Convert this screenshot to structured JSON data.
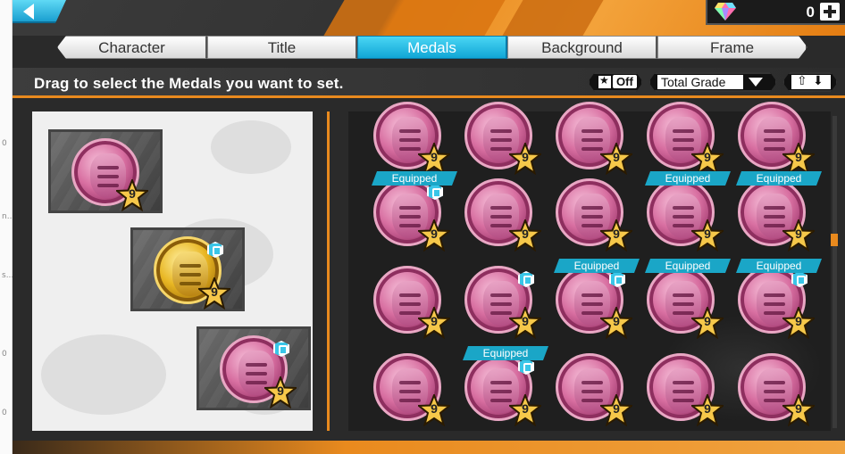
{
  "page_strip": {
    "marks": [
      "0",
      "n...",
      "s...",
      "0",
      "0"
    ]
  },
  "header": {
    "gems": {
      "count": "0"
    }
  },
  "tabs": [
    {
      "label": "Character",
      "active": false
    },
    {
      "label": "Title",
      "active": false
    },
    {
      "label": "Medals",
      "active": true
    },
    {
      "label": "Background",
      "active": false
    },
    {
      "label": "Frame",
      "active": false
    }
  ],
  "toolbar": {
    "instruction": "Drag to select the Medals you want to set.",
    "filter_off_label": "Off",
    "sort_label": "Total Grade"
  },
  "selected_medals": [
    {
      "level": "9",
      "color": "pink",
      "locked": false
    },
    {
      "level": "9",
      "color": "gold",
      "locked": true
    },
    {
      "level": "9",
      "color": "pink",
      "locked": true
    }
  ],
  "medal_grid": {
    "equipped_label": "Equipped",
    "rows": [
      [
        {
          "level": "9"
        },
        {
          "level": "9"
        },
        {
          "level": "9"
        },
        {
          "level": "9"
        },
        {
          "level": "9"
        }
      ],
      [
        {
          "level": "9",
          "equipped": true,
          "locked": true
        },
        {
          "level": "9"
        },
        {
          "level": "9"
        },
        {
          "level": "9",
          "equipped": true
        },
        {
          "level": "9",
          "equipped": true
        }
      ],
      [
        {
          "level": "9"
        },
        {
          "level": "9",
          "locked": true
        },
        {
          "level": "9",
          "equipped": true,
          "locked": true
        },
        {
          "level": "9",
          "equipped": true
        },
        {
          "level": "9",
          "equipped": true,
          "locked": true
        }
      ],
      [
        {
          "level": "9"
        },
        {
          "level": "9",
          "equipped": true,
          "locked": true
        },
        {
          "level": "9"
        },
        {
          "level": "9"
        },
        {
          "level": "9"
        }
      ]
    ]
  },
  "colors": {
    "accent_orange": "#e98a1e",
    "tab_active": "#11a6d6",
    "equipped_tag": "#1aa6c7",
    "medal_pink": "#d86fa1",
    "medal_gold": "#e8b623"
  }
}
